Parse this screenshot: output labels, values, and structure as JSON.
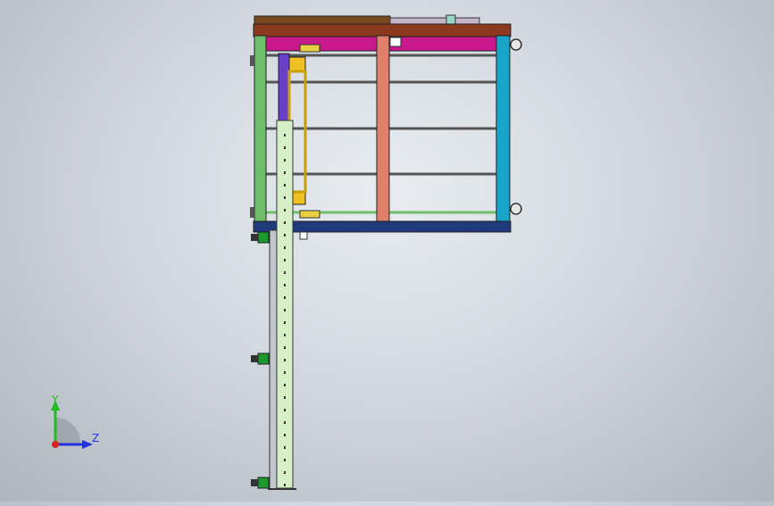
{
  "viewport": {
    "background_top": "#e9edf1",
    "background_bottom": "#aeb6bd"
  },
  "model": {
    "frame_top_color": "#8b3a1e",
    "frame_bottom_color": "#1f3a7a",
    "left_post_color": "#6fbf6a",
    "right_post_color": "#1aa3c8",
    "center_post_color": "#e0806a",
    "magenta_panel_color": "#c8188c",
    "yellow_block_color": "#f0c020",
    "purple_strip_color": "#6a3fc8",
    "column_color": "#d6efc6",
    "foot_color": "#1a9a2a"
  },
  "triad": {
    "y_label": "Y",
    "z_label": "Z",
    "y_color": "#22bb22",
    "z_color": "#2233dd",
    "x_color": "#dd2222"
  }
}
